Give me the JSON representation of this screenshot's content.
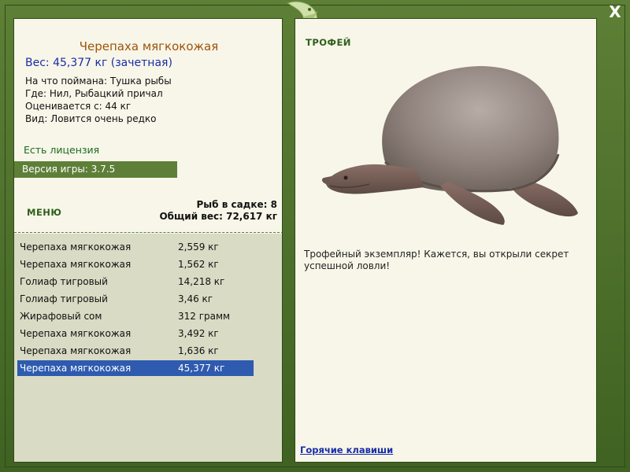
{
  "window": {
    "close_label": "X"
  },
  "fish": {
    "title": "Черепаха мягкокожая",
    "weight_line": "Вес: 45,377 кг (зачетная)",
    "caught_on": "На что поймана: Тушка рыбы",
    "location": "Где: Нил, Рыбацкий причал",
    "valued_from": "Оценивается с: 44 кг",
    "rarity": "Вид: Ловится очень редко"
  },
  "license_text": "Есть лицензия",
  "version_text": "Версия игры: 3.7.5",
  "menu_label": "МЕНЮ",
  "stats": {
    "fish_in_keepnet": "Рыб в садке: 8",
    "total_weight": "Общий вес: 72,617 кг"
  },
  "catch_list": [
    {
      "name": "Черепаха мягкокожая",
      "weight": "2,559 кг"
    },
    {
      "name": "Черепаха мягкокожая",
      "weight": "1,562 кг"
    },
    {
      "name": "Голиаф тигровый",
      "weight": "14,218 кг"
    },
    {
      "name": "Голиаф тигровый",
      "weight": "3,46 кг"
    },
    {
      "name": "Жирафовый сом",
      "weight": "312 грамм"
    },
    {
      "name": "Черепаха мягкокожая",
      "weight": "3,492 кг"
    },
    {
      "name": "Черепаха мягкокожая",
      "weight": "1,636 кг"
    },
    {
      "name": "Черепаха мягкокожая",
      "weight": "45,377 кг"
    }
  ],
  "selected_index": 7,
  "trophy": {
    "label": "ТРОФЕЙ",
    "text": "Трофейный экземпляр! Кажется, вы открыли секрет успешной ловли!"
  },
  "hotkeys_label": "Горячие клавиши",
  "colors": {
    "frame_green": "#4a6b2a",
    "panel_bg": "#f7f6e9",
    "list_bg": "#d9dbc4",
    "selected_row": "#2e5bb0",
    "title_brown": "#a0520c",
    "weight_blue": "#1a2da6"
  },
  "icons": {
    "close": "close-icon",
    "logo": "fish-logo-icon"
  }
}
